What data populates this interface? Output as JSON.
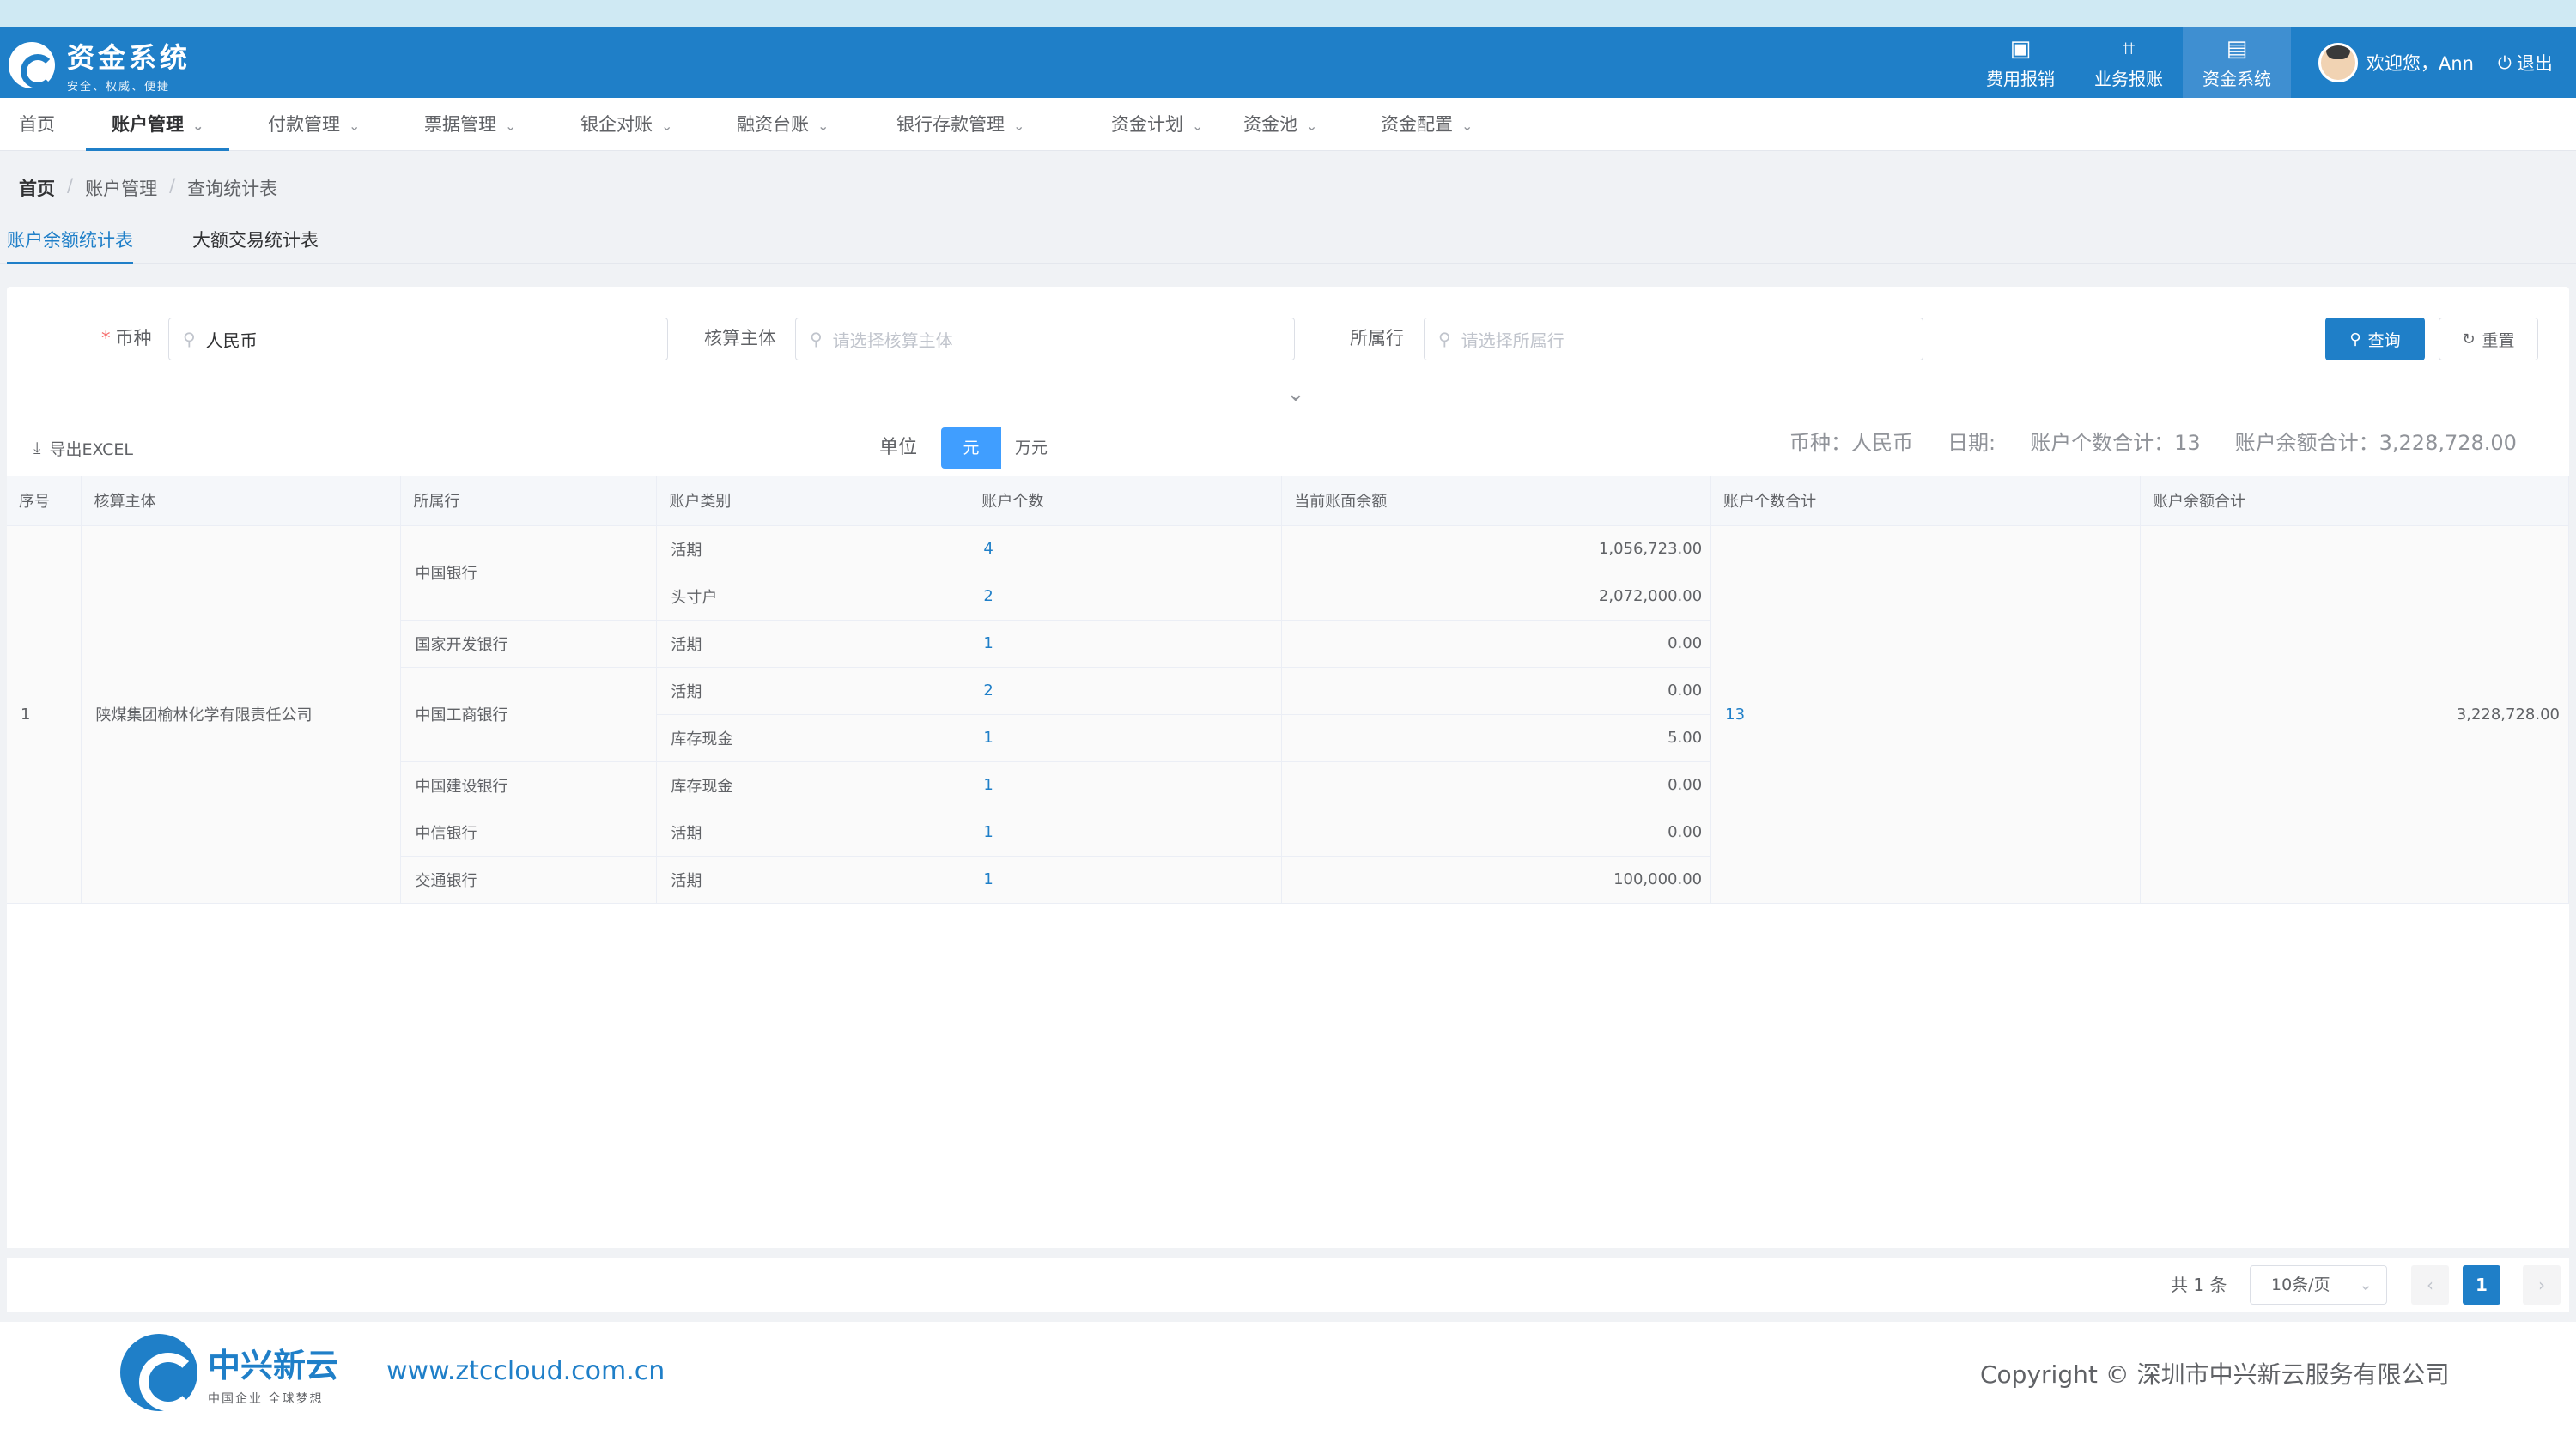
{
  "app": {
    "title": "资金系统",
    "slogan": "安全、权威、便捷"
  },
  "header_nav": [
    {
      "label": "费用报销",
      "icon": "wallet-icon",
      "glyph": "▣"
    },
    {
      "label": "业务报账",
      "icon": "ledger-icon",
      "glyph": "⌗"
    },
    {
      "label": "资金系统",
      "icon": "document-icon",
      "glyph": "▤"
    }
  ],
  "user": {
    "greeting": "欢迎您，Ann",
    "logout": "退出"
  },
  "menu": [
    "首页",
    "账户管理",
    "付款管理",
    "票据管理",
    "银企对账",
    "融资台账",
    "银行存款管理",
    "资金计划",
    "资金池",
    "资金配置"
  ],
  "breadcrumb": [
    "首页",
    "账户管理",
    "查询统计表"
  ],
  "tabs": [
    "账户余额统计表",
    "大额交易统计表"
  ],
  "search": {
    "currency_label": "币种",
    "currency_value": "人民币",
    "entity_label": "核算主体",
    "entity_placeholder": "请选择核算主体",
    "bank_label": "所属行",
    "bank_placeholder": "请选择所属行",
    "query_label": "查询",
    "reset_label": "重置"
  },
  "toolbar": {
    "export_label": "导出EXCEL",
    "unit_label": "单位",
    "unit_options": [
      "元",
      "万元"
    ],
    "summary": {
      "currency": "币种：人民币",
      "date": "日期:",
      "count": "账户个数合计：13",
      "amount": "账户余额合计：3,228,728.00"
    }
  },
  "table": {
    "columns": [
      "序号",
      "核算主体",
      "所属行",
      "账户类别",
      "账户个数",
      "当前账面余额",
      "账户个数合计",
      "账户余额合计"
    ],
    "group": {
      "index": "1",
      "entity": "陕煤集团榆林化学有限责任公司",
      "total_count": "13",
      "total_amount": "3,228,728.00"
    },
    "banks": [
      {
        "name": "中国银行",
        "rows": [
          {
            "type": "活期",
            "count": "4",
            "balance": "1,056,723.00"
          },
          {
            "type": "头寸户",
            "count": "2",
            "balance": "2,072,000.00"
          }
        ]
      },
      {
        "name": "国家开发银行",
        "rows": [
          {
            "type": "活期",
            "count": "1",
            "balance": "0.00"
          }
        ]
      },
      {
        "name": "中国工商银行",
        "rows": [
          {
            "type": "活期",
            "count": "2",
            "balance": "0.00"
          },
          {
            "type": "库存现金",
            "count": "1",
            "balance": "5.00"
          }
        ]
      },
      {
        "name": "中国建设银行",
        "rows": [
          {
            "type": "库存现金",
            "count": "1",
            "balance": "0.00"
          }
        ]
      },
      {
        "name": "中信银行",
        "rows": [
          {
            "type": "活期",
            "count": "1",
            "balance": "0.00"
          }
        ]
      },
      {
        "name": "交通银行",
        "rows": [
          {
            "type": "活期",
            "count": "1",
            "balance": "100,000.00"
          }
        ]
      }
    ]
  },
  "pagination": {
    "total": "共 1 条",
    "page_size": "10条/页",
    "current_page": "1"
  },
  "footer": {
    "brand": "中兴新云",
    "brand_sub": "中国企业 全球梦想",
    "url": "www.ztccloud.com.cn",
    "copyright": "Copyright © 深圳市中兴新云服务有限公司"
  },
  "colors": {
    "primary": "#1f7fc8",
    "header_bg": "#1f7fc8",
    "active_unit": "#409eff"
  }
}
